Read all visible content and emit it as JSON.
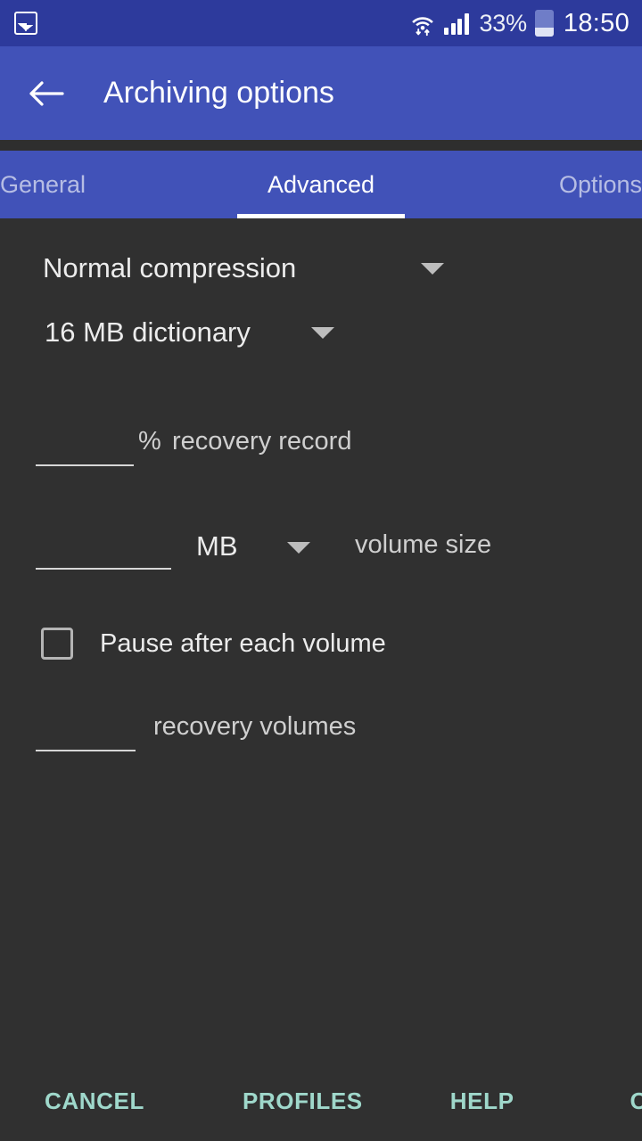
{
  "status_bar": {
    "notification_icon": "photo-icon",
    "wifi_icon": "wifi-icon",
    "signal_icon": "signal-bars-icon",
    "battery_percent": "33%",
    "battery_icon": "battery-icon",
    "time": "18:50"
  },
  "app_bar": {
    "back_icon": "back-arrow-icon",
    "title": "Archiving options"
  },
  "tabs": [
    {
      "label": "General",
      "active": false
    },
    {
      "label": "Advanced",
      "active": true
    },
    {
      "label": "Options",
      "active": false
    }
  ],
  "form": {
    "compression": {
      "value": "Normal compression",
      "caret_icon": "chevron-down-icon"
    },
    "dictionary": {
      "value": "16 MB dictionary",
      "caret_icon": "chevron-down-icon"
    },
    "recovery_record": {
      "value": "",
      "unit": "%",
      "label": "recovery record"
    },
    "volume_size": {
      "value": "",
      "unit": "MB",
      "caret_icon": "chevron-down-icon",
      "label": "volume size"
    },
    "pause_after_volume": {
      "label": "Pause after each volume",
      "checked": false
    },
    "recovery_volumes": {
      "value": "",
      "label": "recovery volumes"
    }
  },
  "buttons": {
    "cancel": "CANCEL",
    "profiles": "PROFILES",
    "help": "HELP",
    "ok": "OK"
  },
  "colors": {
    "status_bar": "#2d3a9c",
    "app_bar": "#4152b8",
    "background": "#303030",
    "accent": "#9fd8cb",
    "tab_indicator": "#ffffff"
  }
}
